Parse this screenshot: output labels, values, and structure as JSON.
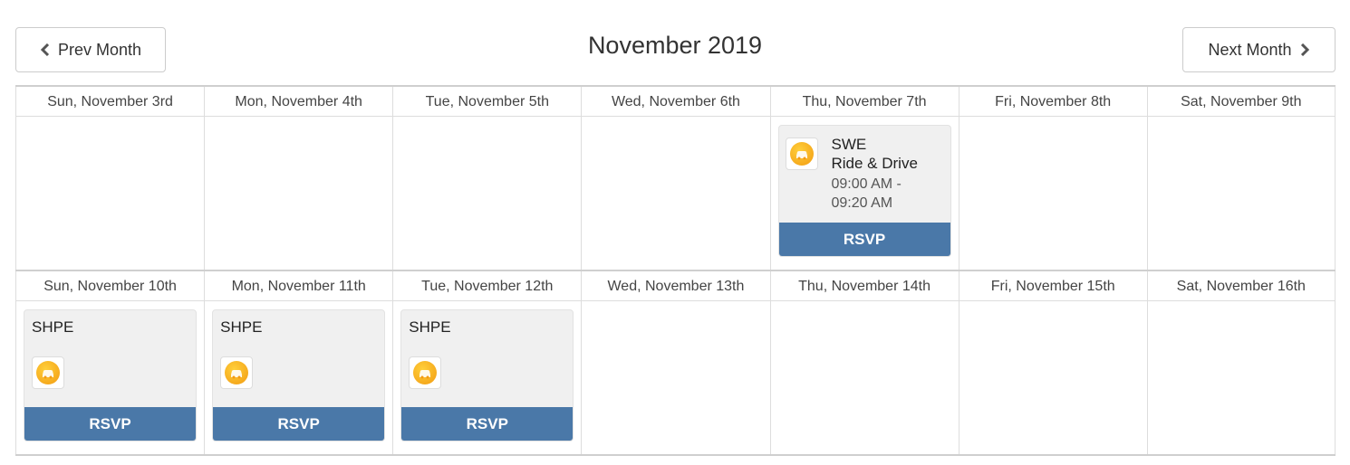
{
  "header": {
    "title": "November 2019",
    "prev_label": "Prev Month",
    "next_label": "Next Month"
  },
  "colors": {
    "rsvp": "#4a78a8",
    "logo": "#f5a623"
  },
  "weeks": [
    {
      "days": [
        {
          "label": "Sun, November 3rd"
        },
        {
          "label": "Mon, November 4th"
        },
        {
          "label": "Tue, November 5th"
        },
        {
          "label": "Wed, November 6th"
        },
        {
          "label": "Thu, November 7th",
          "event": {
            "line1": "SWE",
            "line2": "Ride & Drive",
            "time1": "09:00 AM -",
            "time2": "09:20 AM",
            "rsvp": "RSVP",
            "icon": "car-icon"
          }
        },
        {
          "label": "Fri, November 8th"
        },
        {
          "label": "Sat, November 9th"
        }
      ]
    },
    {
      "days": [
        {
          "label": "Sun, November 10th",
          "event": {
            "title": "SHPE",
            "rsvp": "RSVP",
            "icon": "car-icon"
          }
        },
        {
          "label": "Mon, November 11th",
          "event": {
            "title": "SHPE",
            "rsvp": "RSVP",
            "icon": "car-icon"
          }
        },
        {
          "label": "Tue, November 12th",
          "event": {
            "title": "SHPE",
            "rsvp": "RSVP",
            "icon": "car-icon"
          }
        },
        {
          "label": "Wed, November 13th"
        },
        {
          "label": "Thu, November 14th"
        },
        {
          "label": "Fri, November 15th"
        },
        {
          "label": "Sat, November 16th"
        }
      ]
    }
  ]
}
